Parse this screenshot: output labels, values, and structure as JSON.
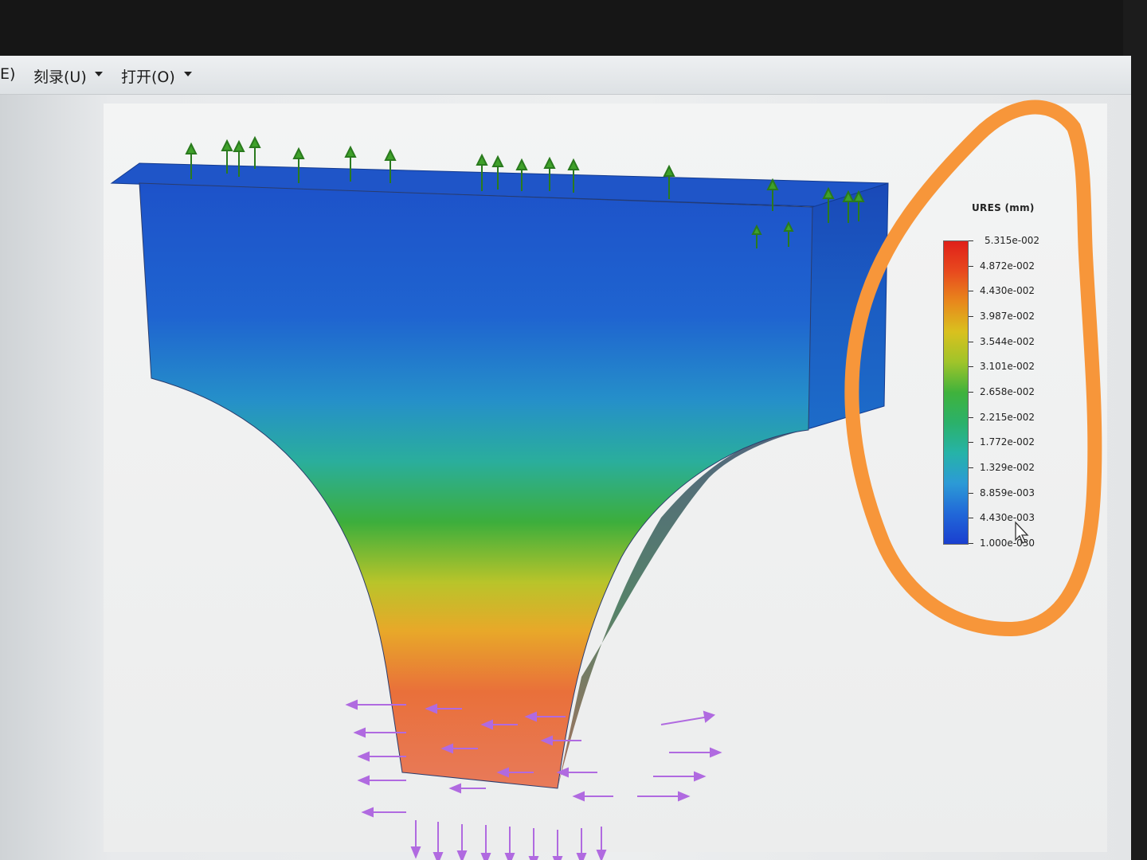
{
  "menubar": {
    "items": [
      {
        "label": "E)"
      },
      {
        "label": "刻录(U)"
      },
      {
        "label": "打开(O)"
      }
    ]
  },
  "legend": {
    "title": "URES (mm)",
    "ticks": [
      "5.315e-002",
      "4.872e-002",
      "4.430e-002",
      "3.987e-002",
      "3.544e-002",
      "3.101e-002",
      "2.658e-002",
      "2.215e-002",
      "1.772e-002",
      "1.329e-002",
      "8.859e-003",
      "4.430e-003",
      "1.000e-030"
    ]
  },
  "colors": {
    "highlight": "#f7963a",
    "fixture_arrow": "#3fa12a",
    "load_arrow": "#b06ae0"
  }
}
